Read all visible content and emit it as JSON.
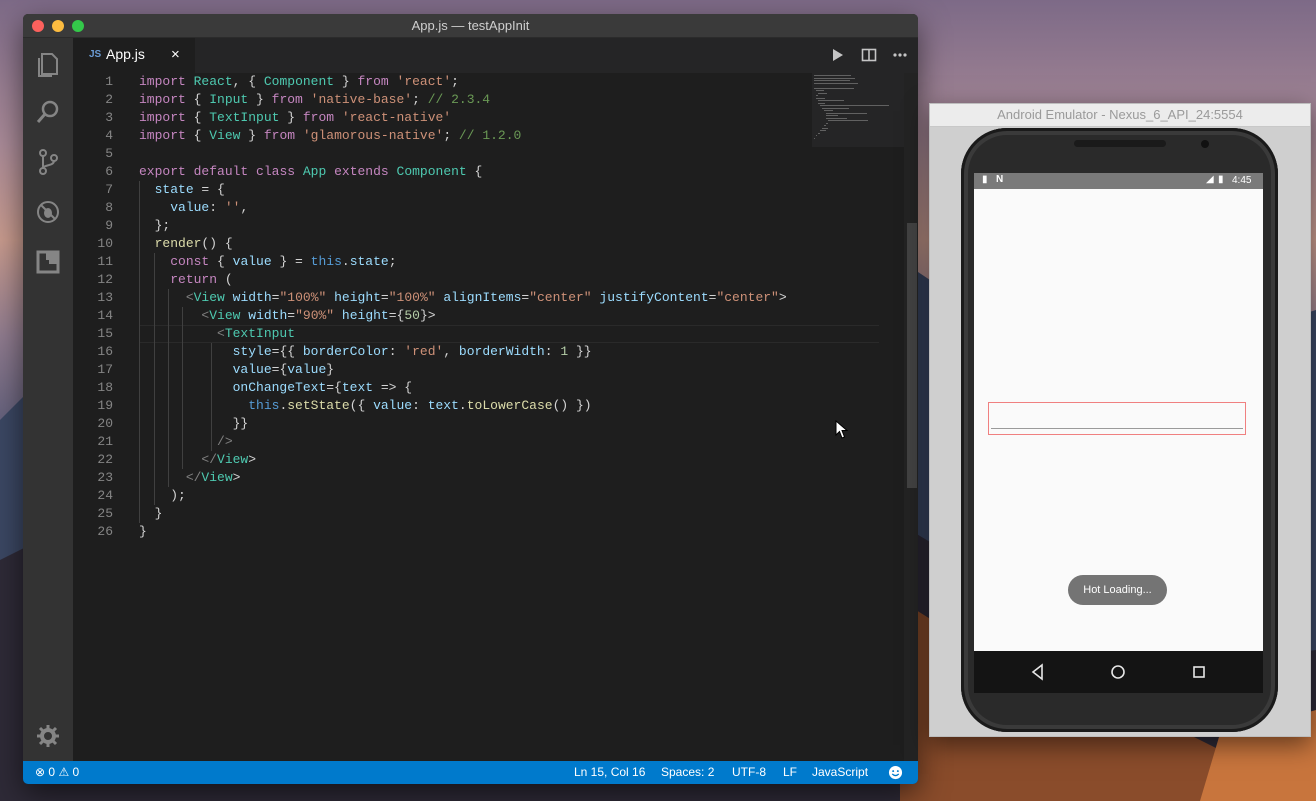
{
  "window": {
    "title": "App.js — testAppInit"
  },
  "tab": {
    "type_badge": "JS",
    "label": "App.js",
    "close": "×"
  },
  "activity_bar": {
    "items": [
      {
        "icon": "files-icon"
      },
      {
        "icon": "search-icon"
      },
      {
        "icon": "source-control-icon"
      },
      {
        "icon": "debug-icon"
      },
      {
        "icon": "extensions-icon"
      }
    ],
    "bottom_icon": "gear-icon"
  },
  "editor_actions": [
    "run-icon",
    "split-editor-icon",
    "more-icon"
  ],
  "code_lines": [
    "import React, { Component } from 'react';",
    "import { Input } from 'native-base'; // 2.3.4",
    "import { TextInput } from 'react-native'",
    "import { View } from 'glamorous-native'; // 1.2.0",
    "",
    "export default class App extends Component {",
    "  state = {",
    "    value: '',",
    "  };",
    "  render() {",
    "    const { value } = this.state;",
    "    return (",
    "      <View width=\"100%\" height=\"100%\" alignItems=\"center\" justifyContent=\"center\">",
    "        <View width=\"90%\" height={50}>",
    "          <TextInput",
    "            style={{ borderColor: 'red', borderWidth: 1 }}",
    "            value={value}",
    "            onChangeText={text => {",
    "              this.setState({ value: text.toLowerCase() })",
    "            }}",
    "          />",
    "        </View>",
    "      </View>",
    "    );",
    "  }",
    "}"
  ],
  "status_bar": {
    "errors": "0",
    "warnings": "0",
    "position": "Ln 15, Col 16",
    "spaces": "Spaces: 2",
    "encoding": "UTF-8",
    "eol": "LF",
    "language": "JavaScript",
    "feedback_icon": "smiley-icon"
  },
  "emulator": {
    "title": "Android Emulator - Nexus_6_API_24:5554",
    "time": "4:45",
    "toast": "Hot Loading...",
    "nav": [
      "back-icon",
      "home-icon",
      "recents-icon"
    ]
  },
  "colors": {
    "statusbar": "#007acc",
    "editor_bg": "#1e1e1e",
    "textinput_border": "#f08080"
  }
}
